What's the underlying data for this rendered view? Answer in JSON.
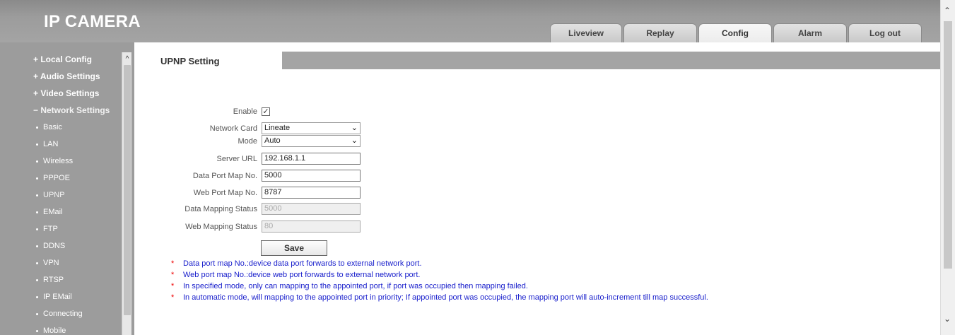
{
  "header": {
    "logo": "IP CAMERA",
    "tabs": [
      {
        "label": "Liveview",
        "active": false
      },
      {
        "label": "Replay",
        "active": false
      },
      {
        "label": "Config",
        "active": true
      },
      {
        "label": "Alarm",
        "active": false
      },
      {
        "label": "Log out",
        "active": false
      }
    ]
  },
  "menu": {
    "groups": [
      "+ Local Config",
      "+ Audio Settings",
      "+ Video Settings",
      "− Network Settings"
    ],
    "items": [
      "Basic",
      "LAN",
      "Wireless",
      "PPPOE",
      "UPNP",
      "EMail",
      "FTP",
      "DDNS",
      "VPN",
      "RTSP",
      "IP EMail",
      "Connecting",
      "Mobile"
    ],
    "active_item": "UPNP",
    "scroll_up_icon": "^"
  },
  "page": {
    "tab_title": "UPNP Setting",
    "fields": {
      "enable_label": "Enable",
      "enable_checked": true,
      "enable_mark": "✓",
      "network_card_label": "Network Card",
      "network_card_value": "Lineate",
      "mode_label": "Mode",
      "mode_value": "Auto",
      "server_url_label": "Server URL",
      "server_url_value": "192.168.1.1",
      "data_port_label": "Data Port Map No.",
      "data_port_value": "5000",
      "web_port_label": "Web Port Map No.",
      "web_port_value": "8787",
      "data_status_label": "Data Mapping Status",
      "data_status_value": "5000",
      "web_status_label": "Web Mapping Status",
      "web_status_value": "80"
    },
    "save_label": "Save",
    "note_marker": "*",
    "notes": [
      "Data port map No.:device data port forwards to external network port.",
      "Web port map No.:device web port forwards to external network port.",
      "In specified mode, only can mapping to the appointed port, if port was occupied then mapping failed.",
      "In automatic mode, will mapping to the appointed port in priority; If appointed port was occupied, the mapping port will auto-increment till map successful."
    ]
  },
  "icons": {
    "chevron_down": "chevron-down-icon",
    "scroll_up": "scroll-up-icon",
    "scroll_down": "scroll-down-icon"
  },
  "colors": {
    "header_bg": "#9c9c9c",
    "note_text": "#1a20cc",
    "note_star": "#e00000"
  }
}
